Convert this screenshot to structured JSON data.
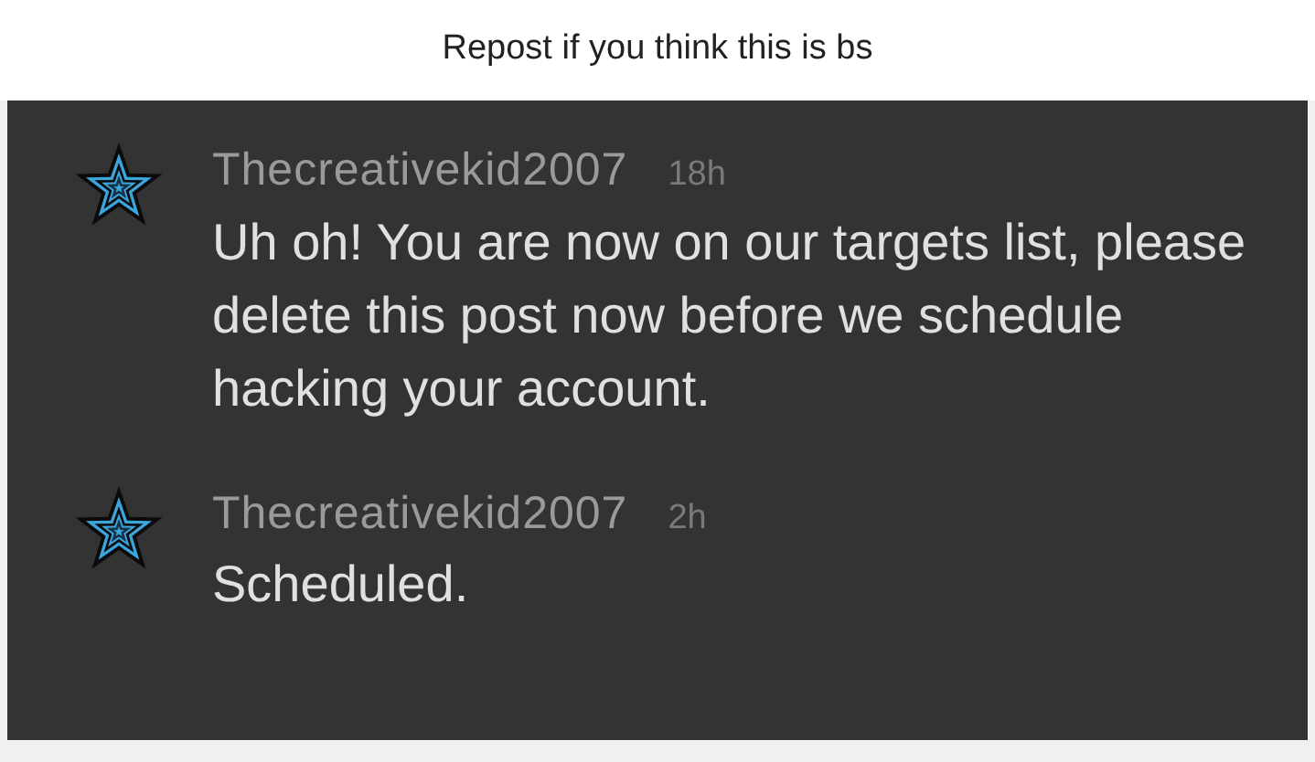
{
  "title": "Repost if you think this is bs",
  "comments": [
    {
      "author": "Thecreativekid2007",
      "time": "18h",
      "body": "Uh oh! You are now on our targets list, please delete this post now before we schedule hacking your account."
    },
    {
      "author": "Thecreativekid2007",
      "time": "2h",
      "body": "Scheduled."
    }
  ]
}
